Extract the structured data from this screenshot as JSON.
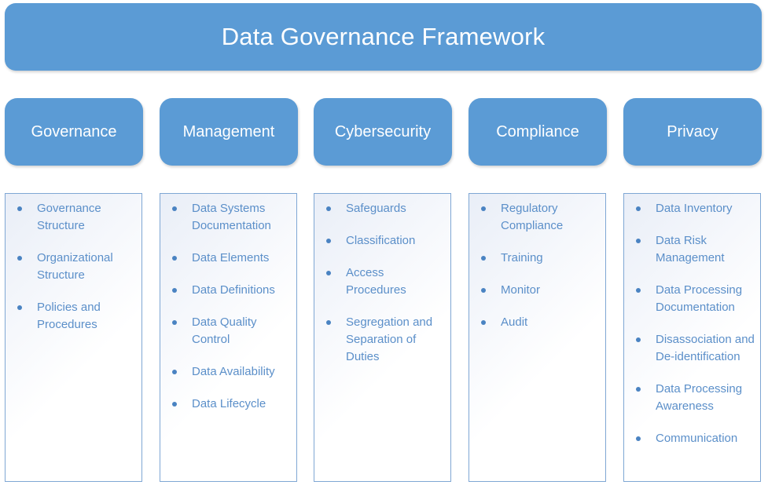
{
  "title": "Data Governance Framework",
  "colors": {
    "box_fill": "#5b9bd5",
    "box_text": "#ffffff",
    "list_text": "#5b8fc9",
    "panel_border": "#7fa7d4"
  },
  "pillars": [
    {
      "label": "Governance",
      "items": [
        "Governance Structure",
        "Organizational Structure",
        "Policies and Procedures"
      ]
    },
    {
      "label": "Management",
      "items": [
        "Data Systems Documentation",
        "Data Elements",
        "Data Definitions",
        "Data Quality Control",
        "Data Availability",
        "Data Lifecycle"
      ]
    },
    {
      "label": "Cybersecurity",
      "items": [
        "Safeguards",
        "Classification",
        "Access Procedures",
        "Segregation and Separation of Duties"
      ]
    },
    {
      "label": "Compliance",
      "items": [
        "Regulatory Compliance",
        "Training",
        "Monitor",
        "Audit"
      ]
    },
    {
      "label": "Privacy",
      "items": [
        "Data Inventory",
        "Data Risk Management",
        "Data Processing Documentation",
        "Disassociation and De-identification",
        "Data Processing Awareness",
        "Communication"
      ]
    }
  ]
}
